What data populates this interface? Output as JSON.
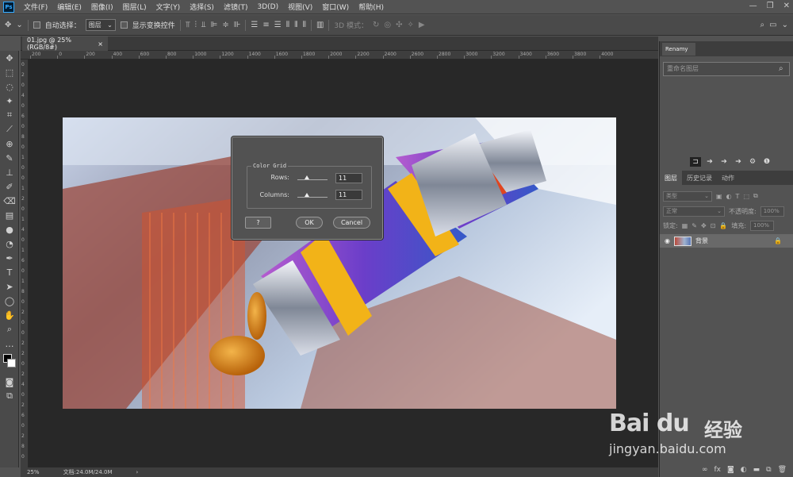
{
  "menubar": {
    "items": [
      "文件(F)",
      "编辑(E)",
      "图像(I)",
      "图层(L)",
      "文字(Y)",
      "选择(S)",
      "滤镜(T)",
      "3D(D)",
      "视图(V)",
      "窗口(W)",
      "帮助(H)"
    ]
  },
  "options": {
    "auto_select_label": "自动选择：",
    "auto_select_value": "图层",
    "show_transform_label": "显示变换控件",
    "mode3d_label": "3D 模式："
  },
  "tab": {
    "title": "01.jpg @ 25%(RGB/8#)",
    "close": "×"
  },
  "ruler": {
    "h_ticks": [
      "200",
      "0",
      "200",
      "400",
      "600",
      "800",
      "1000",
      "1200",
      "1400",
      "1600",
      "1800",
      "2000",
      "2200",
      "2400",
      "2600",
      "2800",
      "3000",
      "3200",
      "3400",
      "3600",
      "3800",
      "4000"
    ],
    "v_ticks": [
      "0",
      "2",
      "0",
      "4",
      "0",
      "6",
      "0",
      "8",
      "0",
      "1",
      "0",
      "0",
      "1",
      "2",
      "0",
      "1",
      "4",
      "0",
      "1",
      "6",
      "0",
      "1",
      "8",
      "0",
      "2",
      "0",
      "0",
      "2",
      "2",
      "0",
      "2",
      "4",
      "0",
      "2",
      "6",
      "0",
      "2",
      "8",
      "0"
    ]
  },
  "dialog": {
    "group_title": "Color Grid",
    "rows_label": "Rows:",
    "rows_value": "11",
    "columns_label": "Columns:",
    "columns_value": "11",
    "help_label": "?",
    "ok_label": "OK",
    "cancel_label": "Cancel"
  },
  "renamy": {
    "tab": "Renamy",
    "search_placeholder": "重命名图层"
  },
  "layers": {
    "tabs": [
      "图层",
      "历史记录",
      "动作"
    ],
    "kind_label": "类型",
    "blend_mode": "正常",
    "opacity_label": "不透明度:",
    "opacity_value": "100%",
    "lock_label": "锁定:",
    "fill_label": "填充:",
    "fill_value": "100%",
    "layer_name": "背景"
  },
  "status": {
    "zoom": "25%",
    "doc": "文档:24.0M/24.0M"
  },
  "watermark": {
    "logo": "Bai du",
    "cn": "经验",
    "url": "jingyan.baidu.com"
  }
}
